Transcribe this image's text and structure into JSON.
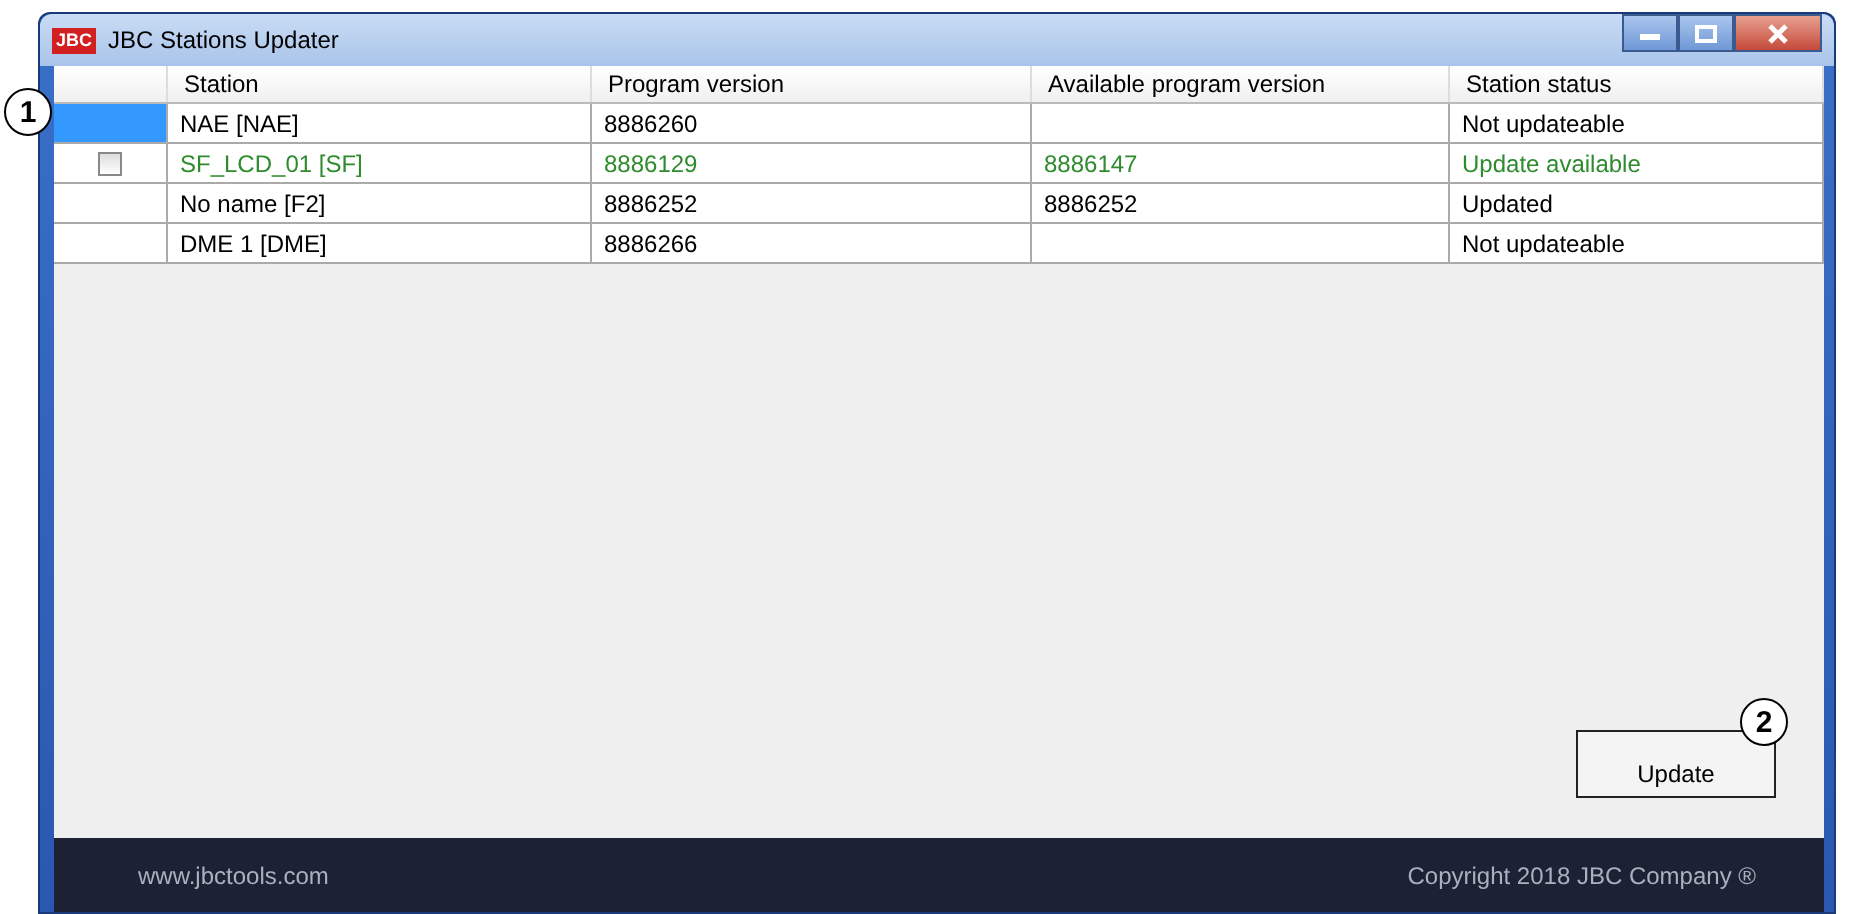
{
  "window": {
    "title": "JBC Stations Updater",
    "logo": "JBC"
  },
  "table": {
    "columns": [
      "Station",
      "Program version",
      "Available program version",
      "Station status"
    ],
    "rows": [
      {
        "selected": true,
        "checkbox": false,
        "color": "#000000",
        "cells": [
          "NAE [NAE]",
          "8886260",
          "",
          "Not updateable"
        ]
      },
      {
        "selected": false,
        "checkbox": true,
        "checked": false,
        "color": "#2e8b2e",
        "cells": [
          "SF_LCD_01 [SF]",
          "8886129",
          "8886147",
          "Update available"
        ]
      },
      {
        "selected": false,
        "checkbox": false,
        "color": "#000000",
        "cells": [
          "No name [F2]",
          "8886252",
          "8886252",
          "Updated"
        ]
      },
      {
        "selected": false,
        "checkbox": false,
        "color": "#000000",
        "cells": [
          "DME 1 [DME]",
          "8886266",
          "",
          "Not updateable"
        ]
      }
    ]
  },
  "buttons": [
    {
      "label": "Update"
    }
  ],
  "footer": {
    "website": "www.jbctools.com",
    "copyright": "Copyright 2018 JBC Company ®"
  },
  "callouts": [
    "1",
    "2"
  ]
}
